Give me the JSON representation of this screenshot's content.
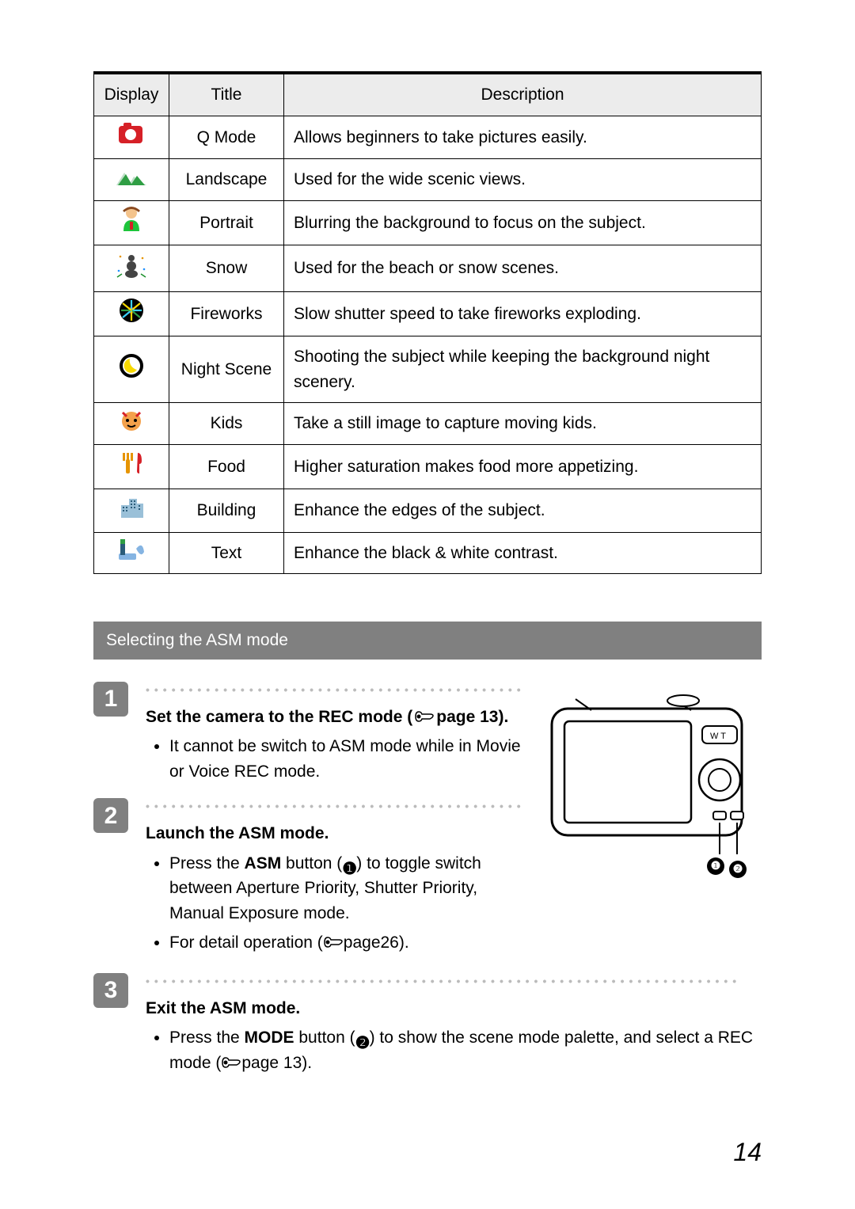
{
  "table": {
    "headers": [
      "Display",
      "Title",
      "Description"
    ],
    "rows": [
      {
        "icon": "q-mode-icon",
        "title": "Q Mode",
        "desc": "Allows beginners to take pictures easily."
      },
      {
        "icon": "landscape-icon",
        "title": "Landscape",
        "desc": "Used for the wide scenic views."
      },
      {
        "icon": "portrait-icon",
        "title": "Portrait",
        "desc": "Blurring the background to focus on the subject."
      },
      {
        "icon": "snow-icon",
        "title": "Snow",
        "desc": "Used for the beach or snow scenes."
      },
      {
        "icon": "fireworks-icon",
        "title": "Fireworks",
        "desc": "Slow shutter speed to take fireworks exploding."
      },
      {
        "icon": "night-scene-icon",
        "title": "Night Scene",
        "desc": "Shooting the subject while keeping the background night scenery."
      },
      {
        "icon": "kids-icon",
        "title": "Kids",
        "desc": "Take a still image to capture moving kids."
      },
      {
        "icon": "food-icon",
        "title": "Food",
        "desc": "Higher saturation makes food more appetizing."
      },
      {
        "icon": "building-icon",
        "title": "Building",
        "desc": "Enhance the edges of the subject."
      },
      {
        "icon": "text-icon",
        "title": "Text",
        "desc": "Enhance the black & white contrast."
      }
    ]
  },
  "section_heading": "Selecting the ASM mode",
  "steps": [
    {
      "num": "1",
      "title_pre": "Set the camera to the REC mode (",
      "title_page_ref": "page 13",
      "title_post": ").",
      "bullets": [
        {
          "text": "It cannot be switch to ASM mode while in Movie or Voice REC mode."
        }
      ]
    },
    {
      "num": "2",
      "title": "Launch the ASM mode.",
      "bullets": [
        {
          "pre": "Press the ",
          "bold": "ASM",
          "mid": " button (",
          "callout": "❶",
          "post": ") to toggle switch between Aperture Priority, Shutter Priority, Manual Exposure mode."
        },
        {
          "pre": "For detail operation (",
          "page_ref": "page26",
          "post": ")."
        }
      ]
    },
    {
      "num": "3",
      "title": "Exit the ASM mode.",
      "bullets": [
        {
          "pre": "Press the ",
          "bold": "MODE",
          "mid": " button (",
          "callout": "❷",
          "post_pre": ") to show the scene mode palette, and select a REC mode (",
          "page_ref": "page 13",
          "post": ")."
        }
      ]
    }
  ],
  "callouts": {
    "one": "❶",
    "two": "❷"
  },
  "page_number": "14"
}
